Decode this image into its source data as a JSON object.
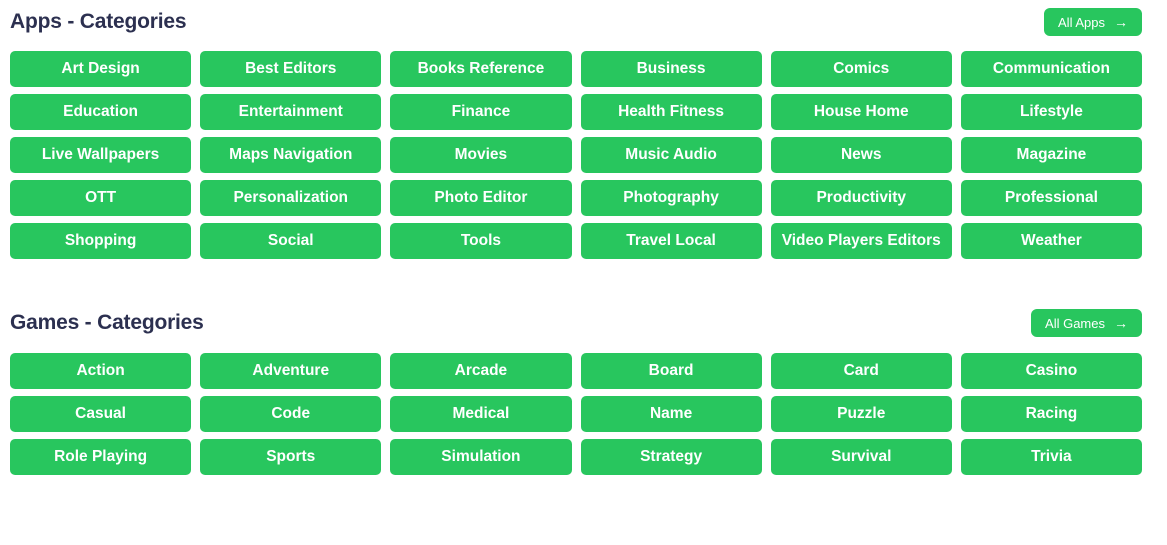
{
  "apps_section": {
    "title": "Apps - Categories",
    "all_button": {
      "label": "All Apps",
      "arrow": "→"
    },
    "categories": [
      "Art Design",
      "Best Editors",
      "Books Reference",
      "Business",
      "Comics",
      "Communication",
      "Education",
      "Entertainment",
      "Finance",
      "Health Fitness",
      "House Home",
      "Lifestyle",
      "Live Wallpapers",
      "Maps Navigation",
      "Movies",
      "Music Audio",
      "News",
      "Magazine",
      "OTT",
      "Personalization",
      "Photo Editor",
      "Photography",
      "Productivity",
      "Professional",
      "Shopping",
      "Social",
      "Tools",
      "Travel Local",
      "Video Players Editors",
      "Weather"
    ]
  },
  "games_section": {
    "title": "Games - Categories",
    "all_button": {
      "label": "All Games",
      "arrow": "→"
    },
    "categories": [
      "Action",
      "Adventure",
      "Arcade",
      "Board",
      "Card",
      "Casino",
      "Casual",
      "Code",
      "Medical",
      "Name",
      "Puzzle",
      "Racing",
      "Role Playing",
      "Sports",
      "Simulation",
      "Strategy",
      "Survival",
      "Trivia"
    ]
  },
  "colors": {
    "tile_green": "#28c65e",
    "heading_navy": "#2c3050",
    "tile_text": "#ffffff",
    "page_background": "#ffffff"
  }
}
